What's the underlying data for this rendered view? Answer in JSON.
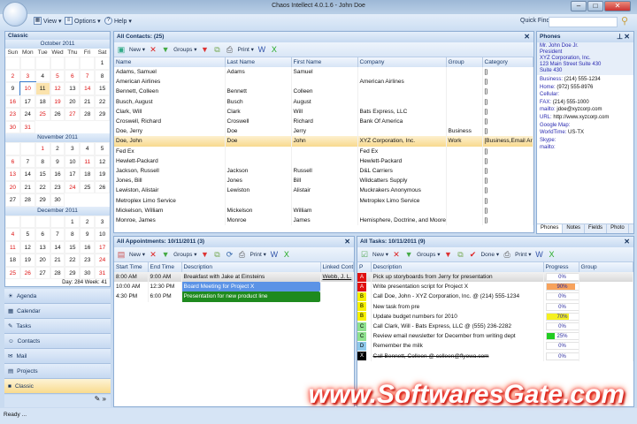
{
  "window": {
    "title": "Chaos Intellect 4.0.1.6 - John Doe",
    "min": "–",
    "max": "□",
    "close": "✕"
  },
  "ribbon": {
    "view": "View ▾",
    "options": "Options ▾",
    "help": "Help ▾",
    "quick_find_label": "Quick Find",
    "quick_find_value": ""
  },
  "left": {
    "header": "Classic",
    "day_info": "Day: 284  Week: 41",
    "day_names": [
      "Sun",
      "Mon",
      "Tue",
      "Wed",
      "Thu",
      "Fri",
      "Sat"
    ],
    "months": [
      {
        "title": "October 2011",
        "offset": 6,
        "days": 31,
        "red": [
          2,
          3,
          5,
          6,
          7,
          10,
          12,
          14,
          16,
          19,
          23,
          25,
          27,
          30,
          31
        ],
        "today": 11,
        "selected": 10
      },
      {
        "title": "November 2011",
        "offset": 2,
        "days": 30,
        "red": [
          1,
          6,
          11,
          13,
          20,
          24
        ]
      },
      {
        "title": "December 2011",
        "offset": 4,
        "days": 31,
        "red": [
          4,
          11,
          17,
          24,
          25,
          26,
          31
        ]
      }
    ],
    "nav": [
      {
        "label": "Agenda",
        "icon": "☀"
      },
      {
        "label": "Calendar",
        "icon": "▦"
      },
      {
        "label": "Tasks",
        "icon": "✎"
      },
      {
        "label": "Contacts",
        "icon": "☺"
      },
      {
        "label": "Mail",
        "icon": "✉"
      },
      {
        "label": "Projects",
        "icon": "▤"
      },
      {
        "label": "Classic",
        "icon": "■",
        "active": true
      }
    ]
  },
  "toolbar": {
    "new": "New ▾",
    "groups": "Groups ▾",
    "print": "Print ▾",
    "done": "Done ▾"
  },
  "contacts": {
    "title": "All Contacts: (25)",
    "columns": [
      "Name",
      "Last Name",
      "First Name",
      "Company",
      "Group",
      "Category"
    ],
    "rows": [
      [
        "Adams, Samuel",
        "Adams",
        "Samuel",
        "",
        "",
        "[]"
      ],
      [
        "American Airlines",
        "",
        "",
        "American Airlines",
        "",
        "[]"
      ],
      [
        "Bennett, Colleen",
        "Bennett",
        "Colleen",
        "",
        "",
        "[]"
      ],
      [
        "Busch, August",
        "Busch",
        "August",
        "",
        "",
        "[]"
      ],
      [
        "Clark, Will",
        "Clark",
        "Will",
        "Bats Express, LLC",
        "",
        "[]"
      ],
      [
        "Croswell, Richard",
        "Croswell",
        "Richard",
        "Bank Of America",
        "",
        "[]"
      ],
      [
        "Doe, Jerry",
        "Doe",
        "Jerry",
        "",
        "Business",
        "[]"
      ],
      [
        "Doe, John",
        "Doe",
        "John",
        "XYZ Corporation, Inc.",
        "Work",
        "[Business,Email Ar"
      ],
      [
        "Fed Ex",
        "",
        "",
        "Fed Ex",
        "",
        "[]"
      ],
      [
        "Hewlett-Packard",
        "",
        "",
        "Hewlett-Packard",
        "",
        "[]"
      ],
      [
        "Jackson, Russell",
        "Jackson",
        "Russell",
        "D&L Carriers",
        "",
        "[]"
      ],
      [
        "Jones, Bill",
        "Jones",
        "Bill",
        "Wildcatters Supply",
        "",
        "[]"
      ],
      [
        "Lewiston, Alistair",
        "Lewiston",
        "Alistair",
        "Muckrakers Anonymous",
        "",
        "[]"
      ],
      [
        "Metroplex Limo Service",
        "",
        "",
        "Metroplex Limo Service",
        "",
        "[]"
      ],
      [
        "Mickelson, William",
        "Mickelson",
        "William",
        "",
        "",
        "[]"
      ],
      [
        "Monroe, James",
        "Monroe",
        "James",
        "Hemisphere, Doctrine, and Moore",
        "",
        "[]"
      ]
    ],
    "selected_index": 7
  },
  "phones": {
    "title": "Phones",
    "header_lines": [
      "Mr. John Doe Jr.",
      "President",
      "XYZ Corporation, Inc.",
      "123 Main Street Suite 430",
      "Suite 430"
    ],
    "fields": [
      [
        "Business",
        "(214) 555-1234"
      ],
      [
        "Home",
        "(972) 555-8976"
      ],
      [
        "Cellular",
        ""
      ],
      [
        "FAX",
        "(214) 555-1000"
      ],
      [
        "mailto",
        "jdoe@xyzcorp.com"
      ],
      [
        "URL",
        "http://www.xyzcorp.com"
      ],
      [
        "Google Map",
        ""
      ],
      [
        "WorldTime",
        "US-TX"
      ],
      [
        "Skype",
        ""
      ],
      [
        "mailto",
        ""
      ]
    ],
    "tabs": [
      "Phones",
      "Notes",
      "Fields",
      "Photo"
    ]
  },
  "appointments": {
    "title": "All Appointments: 10/11/2011  (3)",
    "columns": [
      "Start Time",
      "End Time",
      "Description",
      "Linked Contac"
    ],
    "rows": [
      {
        "start": "8:00 AM",
        "end": "9:00 AM",
        "desc": "Breakfast with Jake at Einsteins",
        "linked": "Webb, J. L.",
        "style": "grey"
      },
      {
        "start": "10:00 AM",
        "end": "12:30 PM",
        "desc": "Board Meeting for Project X",
        "linked": "",
        "style": "blue",
        "color": "#5b93e6"
      },
      {
        "start": "4:30 PM",
        "end": "6:00 PM",
        "desc": "Presentation for new product line",
        "linked": "",
        "style": "green",
        "color": "#1e8a1e"
      }
    ]
  },
  "tasks": {
    "title": "All Tasks: 10/11/2011  (9)",
    "columns": [
      "P",
      "Description",
      "Progress",
      "Group"
    ],
    "rows": [
      {
        "p": "A",
        "pcolor": "#e01010",
        "desc": "Pick up storyboards from Jerry for presentation",
        "progress": 0,
        "bar": "",
        "grey": true
      },
      {
        "p": "A",
        "pcolor": "#e01010",
        "desc": "Write presentation script for Project X",
        "progress": 90,
        "bar": "#f7a25c"
      },
      {
        "p": "B",
        "pcolor": "#f5f000",
        "desc": "Call Doe, John - XYZ Corporation, Inc. @ (214) 555-1234",
        "progress": 0,
        "bar": ""
      },
      {
        "p": "B",
        "pcolor": "#f5f000",
        "desc": "New task from pre",
        "progress": 0,
        "bar": ""
      },
      {
        "p": "B",
        "pcolor": "#f5f000",
        "desc": "Update budget numbers for 2010",
        "progress": 70,
        "bar": "#f5f020"
      },
      {
        "p": "C",
        "pcolor": "#8ee08e",
        "desc": "Call Clark, Will - Bats Express, LLC @ (555) 236-2282",
        "progress": 0,
        "bar": ""
      },
      {
        "p": "C",
        "pcolor": "#8ee08e",
        "desc": "Review email newsletter for December from writing dept",
        "progress": 25,
        "bar": "#22cc22"
      },
      {
        "p": "D",
        "pcolor": "#8ec8ea",
        "desc": "Remember the milk",
        "progress": 0,
        "bar": ""
      },
      {
        "p": "X",
        "pcolor": "#000000",
        "desc": "Call Bennett, Colleen @ colleen@flyowa.com",
        "progress": 0,
        "bar": "",
        "strike": true
      }
    ]
  },
  "status": "Ready ...",
  "watermark": "www.SoftwaresGate.com"
}
